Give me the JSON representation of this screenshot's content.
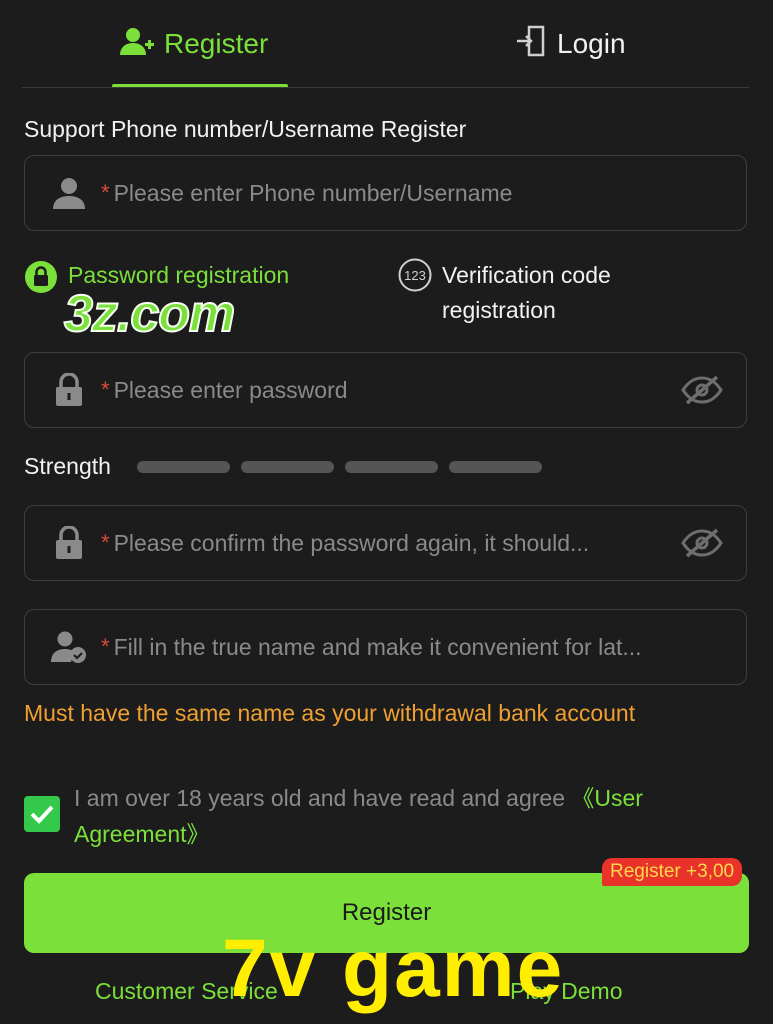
{
  "tabs": {
    "register": "Register",
    "login": "Login"
  },
  "form": {
    "support_label": "Support Phone number/Username Register",
    "username_placeholder": "Please enter Phone number/Username",
    "required_mark": "*",
    "mode_password": "Password registration",
    "mode_code_icon_text": "123",
    "mode_code": "Verification code registration",
    "password_placeholder": "Please enter password",
    "strength_label": "Strength",
    "strength_level": 0,
    "confirm_placeholder": "Please confirm the password again, it should...",
    "realname_placeholder": "Fill in the true name and make it convenient for lat...",
    "realname_warning": "Must have the same name as your withdrawal bank account"
  },
  "agreement": {
    "checked": true,
    "text": "I am over 18 years old and have read and agree ",
    "link": "《User Agreement》"
  },
  "register_button": {
    "label": "Register",
    "badge": "Register +3,00"
  },
  "footer": {
    "customer_service": "Customer Service",
    "play_demo": "Play Demo"
  },
  "overlays": {
    "watermark": "3z.com",
    "brand": "7v  game"
  },
  "colors": {
    "accent": "#7be03a",
    "warning": "#f0a030",
    "badge": "#e8322a",
    "checkbox": "#34c94a",
    "background": "#1c1c1c"
  },
  "icons": [
    "user-plus-icon",
    "login-door-icon",
    "user-icon",
    "lock-badge-icon",
    "numeric-123-icon",
    "lock-icon",
    "eye-slash-icon",
    "user-check-icon",
    "checkmark-icon"
  ]
}
